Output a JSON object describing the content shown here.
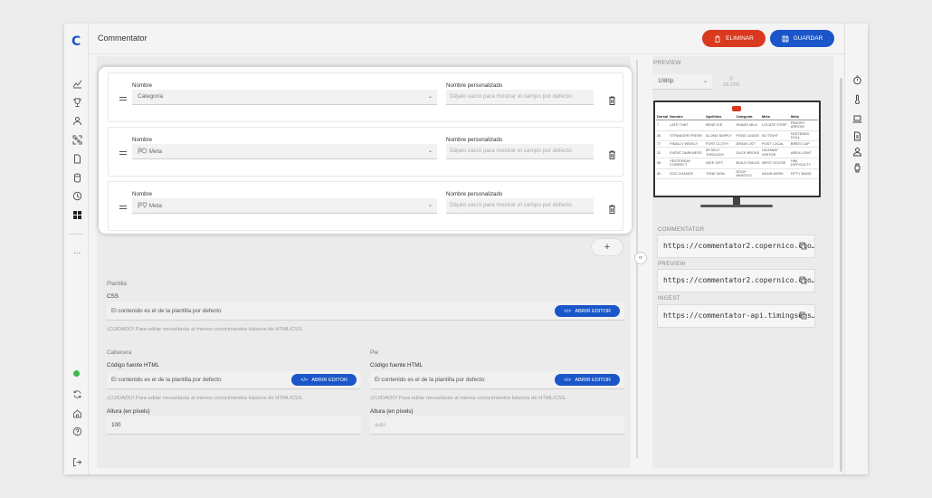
{
  "app": {
    "logo": "C",
    "title": "Commentator"
  },
  "actions": {
    "delete_label": "ELIMINAR",
    "save_label": "GUARDAR"
  },
  "rail": {
    "icons": [
      "chart-icon",
      "trophy-icon",
      "user-icon",
      "qr-icon",
      "document-icon",
      "database-icon",
      "clock-icon",
      "grid-icon"
    ],
    "more": "...",
    "status_color": "#3dbb4a"
  },
  "fields": [
    {
      "name_label": "Nombre",
      "name_value": "Categoría",
      "custom_label": "Nombre personalizado",
      "custom_placeholder": "Déjalo vacío para mostrar el campo por defecto."
    },
    {
      "name_label": "Nombre",
      "name_value": "Meta",
      "custom_label": "Nombre personalizado",
      "custom_placeholder": "Déjalo vacío para mostrar el campo por defecto."
    },
    {
      "name_label": "Nombre",
      "name_value": "Meta",
      "custom_label": "Nombre personalizado",
      "custom_placeholder": "Déjalo vacío para mostrar el campo por defecto."
    }
  ],
  "add_label": "+",
  "template": {
    "section": "Plantilla",
    "css_label": "CSS",
    "css_value": "El contenido es el de la plantilla por defecto",
    "css_warning": "¡CUIDADO! Para editar necesitarás al menos conocimientos básicos de HTML/CSS.",
    "editor_label": "ABRIR EDITOR",
    "header": {
      "section": "Cabecera",
      "html_label": "Código fuente HTML",
      "html_value": "El contenido es el de la plantilla por defecto",
      "warning": "¡CUIDADO! Para editar necesitarás al menos conocimientos básicos de HTML/CSS.",
      "height_label": "Altura (en píxels)",
      "height_value": "100"
    },
    "footer": {
      "section": "Pie",
      "html_label": "Código fuente HTML",
      "html_value": "El contenido es el de la plantilla por defecto",
      "warning": "¡CUIDADO! Para editar necesitarás al menos conocimientos básicos de HTML/CSS.",
      "height_label": "Altura (en píxels)",
      "height_placeholder": "auto"
    }
  },
  "preview": {
    "section": "PREVIEW",
    "resolution": "1080p",
    "zoom": "18.13%",
    "table": {
      "headers": [
        "Dorsal",
        "Nombre",
        "Apellidos",
        "Categoría",
        "Meta",
        "Meta"
      ],
      "rows": [
        [
          "7",
          "LATE THAT",
          "BEND ICE",
          "SHADE MILK",
          "LOCATE STRIP",
          "PAVORY ARROW"
        ],
        [
          "56",
          "STRANGER FRESH",
          "ALONG SIMPLY",
          "POND JUDGE",
          "SO TIGHT",
          "FASTENED DOLL"
        ],
        [
          "77",
          "FINALLY WIDELY",
          "FORT CLOTH",
          "DRAW LIST",
          "POST LOCAL",
          "BIRDS CAP"
        ],
        [
          "32",
          "EVENT DARKNESS",
          "MYSELF THROUGH",
          "DUCK BROKE",
          "HIGHWAY VISITOR",
          "AREA LIGHT"
        ],
        [
          "58",
          "YESTERDAY CORRECT",
          "NICE GIFT",
          "BUILD FAILED",
          "WEST GOOSE",
          "HIM DIFFICULTY"
        ],
        [
          "80",
          "ZOO CHANCE",
          "TONE SKIN",
          "ROOF WHISTLE",
          "NOUN WEEK",
          "FIFTY BAND"
        ]
      ]
    }
  },
  "links": [
    {
      "label": "COMMENTATOR",
      "url": "https://commentator2.copernico.clo…"
    },
    {
      "label": "PREVIEW",
      "url": "https://commentator2.copernico.clo…"
    },
    {
      "label": "INGEST",
      "url": "https://commentator-api.timingsens…"
    }
  ],
  "right_rail": {
    "icons": [
      "timer-icon",
      "thermometer-icon",
      "laptop-icon",
      "document-icon",
      "user-plus-icon",
      "watch-icon"
    ]
  },
  "colors": {
    "accent": "#1a56c9",
    "danger": "#d9391c"
  }
}
